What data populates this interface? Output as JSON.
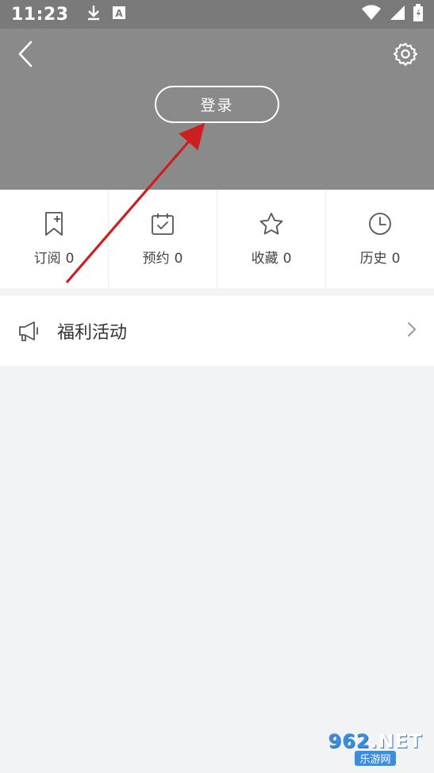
{
  "status_bar": {
    "time": "11:23",
    "left_icons": [
      "download-icon",
      "text-a-icon"
    ],
    "right_icons": [
      "wifi-icon",
      "signal-icon",
      "battery-icon"
    ]
  },
  "header": {
    "back_icon": "chevron-left-icon",
    "settings_icon": "gear-icon",
    "login_label": "登录",
    "background": "#8a8a8a"
  },
  "stats": [
    {
      "id": "subscribe",
      "label": "订阅",
      "count": "0",
      "icon": "bookmark-plus-icon"
    },
    {
      "id": "reserve",
      "label": "预约",
      "count": "0",
      "icon": "calendar-check-icon"
    },
    {
      "id": "favorite",
      "label": "收藏",
      "count": "0",
      "icon": "star-icon"
    },
    {
      "id": "history",
      "label": "历史",
      "count": "0",
      "icon": "clock-icon"
    }
  ],
  "welfare": {
    "label": "福利活动",
    "icon": "megaphone-icon",
    "chevron": "chevron-right-icon"
  },
  "annotation": {
    "color": "#cc1f1f"
  },
  "watermark": {
    "brand_number": "962",
    "brand_suffix": ".NET",
    "sub": "乐游网"
  }
}
